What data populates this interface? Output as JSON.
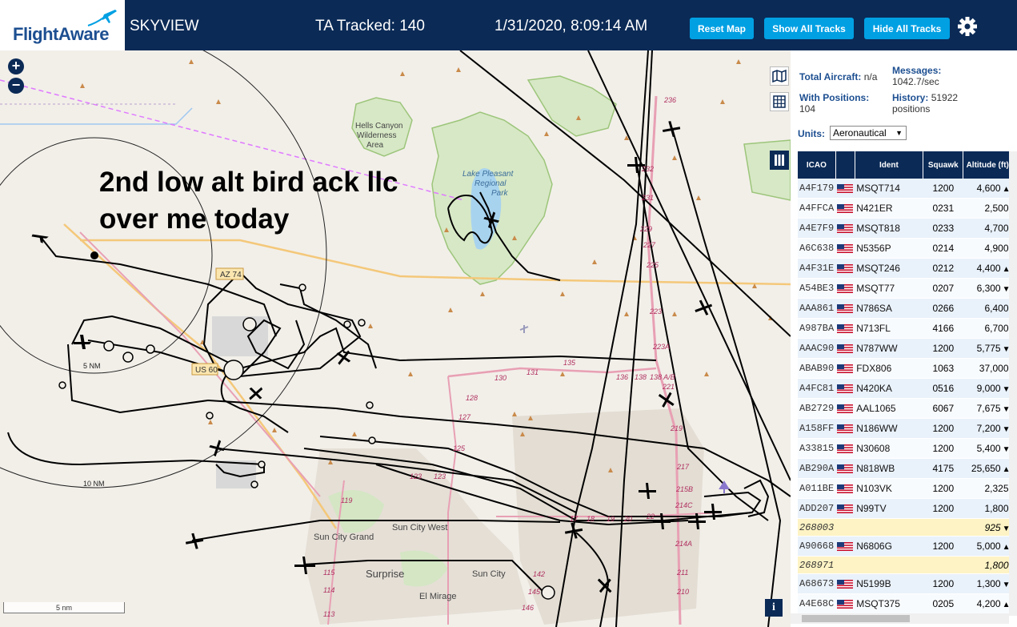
{
  "header": {
    "logo": "FlightAware",
    "app_name": "SKYVIEW",
    "tracked": "TA Tracked: 140",
    "datetime": "1/31/2020, 8:09:14 AM",
    "buttons": {
      "reset": "Reset Map",
      "show_all": "Show All Tracks",
      "hide_all": "Hide All Tracks"
    },
    "settings_icon": "gear-icon"
  },
  "map": {
    "zoom_in": "+",
    "zoom_out": "−",
    "annotation_line1": "2nd low alt bird ack llc",
    "annotation_line2": "over me today",
    "scale": "5 nm",
    "info": "i",
    "labels": {
      "hells_canyon": "Hells Canyon",
      "wilderness": "Wilderness",
      "area": "Area",
      "lake1": "Lake Pleasant",
      "lake2": "Regional",
      "lake3": "Park",
      "az74": "AZ 74",
      "us60": "US 60",
      "sun_city_grand": "Sun City Grand",
      "sun_city_west": "Sun City West",
      "surprise": "Surprise",
      "sun_city": "Sun City",
      "el_mirage": "El Mirage",
      "ring_5": "5 NM",
      "ring_10": "10 NM"
    },
    "road_numbers": [
      "236",
      "232",
      "231",
      "229",
      "227",
      "225",
      "223",
      "223A",
      "221",
      "219",
      "217",
      "215B",
      "214C",
      "214A",
      "211",
      "210",
      "125",
      "123",
      "123",
      "127",
      "128",
      "130",
      "131",
      "135",
      "138",
      "119",
      "115",
      "114",
      "113",
      "17",
      "18",
      "19",
      "20",
      "22",
      "142",
      "145",
      "146",
      "136",
      "138 A/B"
    ]
  },
  "panel": {
    "total_label": "Total Aircraft:",
    "total_value": "n/a",
    "messages_label": "Messages:",
    "messages_value": "1042.7/sec",
    "positions_label": "With Positions:",
    "positions_value": "104",
    "history_label": "History:",
    "history_value": "51922",
    "history_unit": "positions",
    "units_label": "Units:",
    "units_value": "Aeronautical",
    "columns": {
      "icao": "ICAO",
      "ident": "Ident",
      "squawk": "Squawk",
      "altitude": "Altitude (ft)"
    },
    "rows": [
      {
        "icao": "A4F179",
        "flag": true,
        "ident": "MSQT714",
        "squawk": "1200",
        "alt": "4,600",
        "trend": "▲"
      },
      {
        "icao": "A4FFCA",
        "flag": true,
        "ident": "N421ER",
        "squawk": "0231",
        "alt": "2,500",
        "trend": ""
      },
      {
        "icao": "A4E7F9",
        "flag": true,
        "ident": "MSQT818",
        "squawk": "0233",
        "alt": "4,700",
        "trend": ""
      },
      {
        "icao": "A6C638",
        "flag": true,
        "ident": "N5356P",
        "squawk": "0214",
        "alt": "4,900",
        "trend": ""
      },
      {
        "icao": "A4F31E",
        "flag": true,
        "ident": "MSQT246",
        "squawk": "0212",
        "alt": "4,400",
        "trend": "▲"
      },
      {
        "icao": "A54BE3",
        "flag": true,
        "ident": "MSQT77",
        "squawk": "0207",
        "alt": "6,300",
        "trend": "▼"
      },
      {
        "icao": "AAA861",
        "flag": true,
        "ident": "N786SA",
        "squawk": "0266",
        "alt": "6,400",
        "trend": ""
      },
      {
        "icao": "A987BA",
        "flag": true,
        "ident": "N713FL",
        "squawk": "4166",
        "alt": "6,700",
        "trend": ""
      },
      {
        "icao": "AAAC90",
        "flag": true,
        "ident": "N787WW",
        "squawk": "1200",
        "alt": "5,775",
        "trend": "▼"
      },
      {
        "icao": "ABAB90",
        "flag": true,
        "ident": "FDX806",
        "squawk": "1063",
        "alt": "37,000",
        "trend": ""
      },
      {
        "icao": "A4FC81",
        "flag": true,
        "ident": "N420KA",
        "squawk": "0516",
        "alt": "9,000",
        "trend": "▼"
      },
      {
        "icao": "AB2729",
        "flag": true,
        "ident": "AAL1065",
        "squawk": "6067",
        "alt": "7,675",
        "trend": "▼"
      },
      {
        "icao": "A158FF",
        "flag": true,
        "ident": "N186WW",
        "squawk": "1200",
        "alt": "7,200",
        "trend": "▼"
      },
      {
        "icao": "A33815",
        "flag": true,
        "ident": "N30608",
        "squawk": "1200",
        "alt": "5,400",
        "trend": "▼"
      },
      {
        "icao": "AB290A",
        "flag": true,
        "ident": "N818WB",
        "squawk": "4175",
        "alt": "25,650",
        "trend": "▲"
      },
      {
        "icao": "A011BE",
        "flag": true,
        "ident": "N103VK",
        "squawk": "1200",
        "alt": "2,325",
        "trend": ""
      },
      {
        "icao": "ADD207",
        "flag": true,
        "ident": "N99TV",
        "squawk": "1200",
        "alt": "1,800",
        "trend": ""
      },
      {
        "icao": "268003",
        "flag": false,
        "ident": "",
        "squawk": "",
        "alt": "925",
        "trend": "▼"
      },
      {
        "icao": "A90668",
        "flag": true,
        "ident": "N6806G",
        "squawk": "1200",
        "alt": "5,000",
        "trend": "▲"
      },
      {
        "icao": "268971",
        "flag": false,
        "ident": "",
        "squawk": "",
        "alt": "1,800",
        "trend": ""
      },
      {
        "icao": "A68673",
        "flag": true,
        "ident": "N5199B",
        "squawk": "1200",
        "alt": "1,300",
        "trend": "▼"
      },
      {
        "icao": "A4E68C",
        "flag": true,
        "ident": "MSQT375",
        "squawk": "0205",
        "alt": "4,200",
        "trend": "▲"
      }
    ]
  },
  "colors": {
    "header_bg": "#0b2a56",
    "button": "#00a0e3",
    "track": "#000000",
    "terrain": "#c98a4a",
    "road": "#e8a0b4",
    "highway": "#f4c87a"
  }
}
